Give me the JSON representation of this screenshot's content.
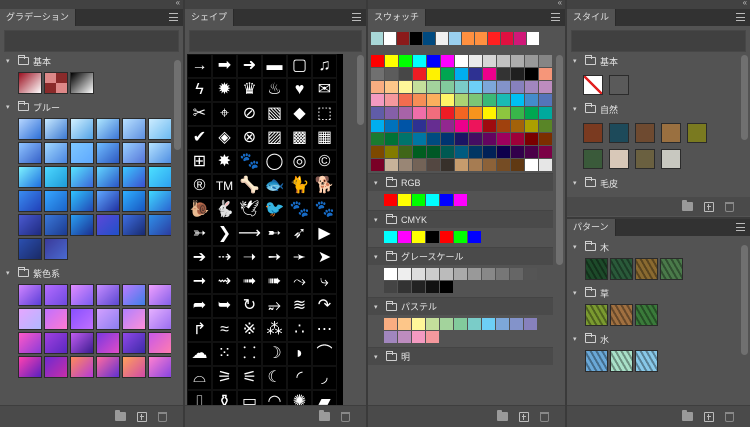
{
  "gradients_panel": {
    "tab": "グラデーション",
    "groups": [
      {
        "name": "基本",
        "items": [
          "linear-gradient(135deg,#9b1020,#ffffff)",
          "repeating-conic-gradient(#8a2a2a 0 25%,#d88 0 50%)",
          "linear-gradient(135deg,#000000,#ffffff)"
        ]
      },
      {
        "name": "ブルー",
        "items": [
          "linear-gradient(135deg,#b6d6ff,#2d6fd6)",
          "linear-gradient(135deg,#c6e8ff,#3b78d0)",
          "linear-gradient(135deg,#d2f1ff,#52a2e6)",
          "linear-gradient(135deg,#aee6ff,#3c76d6)",
          "linear-gradient(135deg,#b8e0ff,#5d8fe0)",
          "linear-gradient(135deg,#ccecff,#6bb9f0)",
          "linear-gradient(135deg,#8fc4ff,#3560c8)",
          "linear-gradient(135deg,#a0d8ff,#4a84e0)",
          "linear-gradient(135deg,#7ec8ff,#5ea8ff)",
          "linear-gradient(135deg,#6fbcff,#2d58c0)",
          "linear-gradient(135deg,#98d0ff,#5575d8)",
          "linear-gradient(135deg,#b5e3ff,#4e8de2)",
          "linear-gradient(135deg,#7df2ff,#1f6fe0)",
          "linear-gradient(135deg,#4dd8ff,#1e9ad8)",
          "linear-gradient(135deg,#58e5ff,#3a66d9)",
          "linear-gradient(135deg,#62d4ff,#2b55c6)",
          "linear-gradient(135deg,#3cc8ff,#3b4fd0)",
          "linear-gradient(135deg,#4ce0ff,#2ea0f0)",
          "linear-gradient(135deg,#3a8cf0,#2140b8)",
          "linear-gradient(135deg,#36a6ff,#1b63c8)",
          "linear-gradient(135deg,#2fc4ff,#2247b5)",
          "linear-gradient(135deg,#5fa8ff,#2030a0)",
          "linear-gradient(135deg,#2fb0ff,#1855c0)",
          "linear-gradient(135deg,#40d8ff,#2a62d0)",
          "linear-gradient(135deg,#4a5ad0,#1e2a80)",
          "linear-gradient(135deg,#3a78d8,#1c3a90)",
          "linear-gradient(135deg,#2a9ef0,#1b2f90)",
          "linear-gradient(135deg,#5c48d8,#2050c8)",
          "linear-gradient(135deg,#3e6ee0,#182a70)",
          "linear-gradient(135deg,#2f8fe8,#2b3ca0)",
          "linear-gradient(135deg,#2b4fb0,#1a2a66)",
          "linear-gradient(135deg,#3a3a9a,#4a6ad0)"
        ]
      },
      {
        "name": "紫色系",
        "items": [
          "linear-gradient(135deg,#d084ff,#5a3fd8)",
          "linear-gradient(135deg,#b46bff,#6e4ae0)",
          "linear-gradient(135deg,#e08cff,#7a5cf0)",
          "linear-gradient(135deg,#c58bff,#5a48d0)",
          "linear-gradient(135deg,#ba7cff,#3f7ee8)",
          "linear-gradient(135deg,#f0a0ff,#8460e8)",
          "linear-gradient(135deg,#e6a6ff,#b0b8ff)",
          "linear-gradient(135deg,#c070ff,#ff7ad0)",
          "linear-gradient(135deg,#8850ff,#c070ff)",
          "linear-gradient(135deg,#d3a0ff,#8c7ef0)",
          "linear-gradient(135deg,#b080ff,#ff90d8)",
          "linear-gradient(135deg,#e6b0ff,#9a6ef0)",
          "linear-gradient(135deg,#ff58c8,#8a3cd8)",
          "linear-gradient(135deg,#a040e0,#5a28c0)",
          "linear-gradient(135deg,#c05cf0,#3b1c90)",
          "linear-gradient(135deg,#7a38e0,#e04cc8)",
          "linear-gradient(135deg,#9048e8,#3c2aa8)",
          "linear-gradient(135deg,#c858e8,#ff7cb0)",
          "linear-gradient(135deg,#ff40b0,#5820c0)",
          "linear-gradient(135deg,#6f2ad0,#c82ea8)",
          "linear-gradient(135deg,#ff8a5a,#b43ad8)",
          "linear-gradient(135deg,#ff6aa0,#6030d0)",
          "linear-gradient(135deg,#ffa05a,#d04aa8)",
          "linear-gradient(135deg,#ff80d0,#8844e0)"
        ]
      }
    ]
  },
  "shapes_panel": {
    "tab": "シェイプ",
    "shapes": [
      "→",
      "➡",
      "➜",
      "▬",
      "▢",
      "♫",
      "ϟ",
      "✹",
      "♛",
      "♨",
      "♥",
      "✉",
      "✂",
      "⌖",
      "⊘",
      "▧",
      "◆",
      "⬚",
      "✔",
      "◈",
      "⊗",
      "▨",
      "▩",
      "▦",
      "⊞",
      "✸",
      "🐾",
      "◯",
      "◎",
      "©",
      "®",
      "TM",
      "🦴",
      "🐟",
      "🐈",
      "🐕",
      "🐌",
      "🐇",
      "🕊",
      "🐦",
      "🐾",
      "🐾",
      "➳",
      "❯",
      "⟶",
      "➸",
      "➶",
      "▶",
      "➔",
      "⇢",
      "➝",
      "➙",
      "➛",
      "➤",
      "➞",
      "⇝",
      "➟",
      "➠",
      "⤳",
      "⤷",
      "➦",
      "➥",
      "↻",
      "⥴",
      "≋",
      "↷",
      "↱",
      "≈",
      "※",
      "⁂",
      "∴",
      "⋯",
      "☁",
      "⁙",
      "⸬",
      "☽",
      "◗",
      "⌒",
      "⌓",
      "⚞",
      "⚟",
      "☾",
      "◜",
      "◞",
      "⎍",
      "⚱",
      "▭",
      "◠",
      "✺",
      "▰"
    ]
  },
  "swatches_panel": {
    "tab": "スウォッチ",
    "recent": [
      "#a8d8d8",
      "#ffffff",
      "#8b1a1a",
      "#000000",
      "#004a80",
      "#f0f0f0",
      "#9ad0f0",
      "#ff9040",
      "#ff9040",
      "#ff2020",
      "#e01040",
      "#d01878",
      "#ffffff"
    ],
    "grid": [
      "#ff0000",
      "#ffff00",
      "#00ff00",
      "#00ffff",
      "#0000ff",
      "#ff00ff",
      "#ffffff",
      "#ebebeb",
      "#d6d6d6",
      "#c2c2c2",
      "#adadad",
      "#999999",
      "#858585",
      "#707070",
      "#5c5c5c",
      "#474747",
      "#ed1c24",
      "#fff200",
      "#00a651",
      "#00aeef",
      "#2e3192",
      "#ec008c",
      "#333333",
      "#1f1f1f",
      "#000000",
      "#f69679",
      "#f9ad81",
      "#fdc689",
      "#fff799",
      "#c4df9b",
      "#a3d39c",
      "#82ca9c",
      "#7accc8",
      "#6dcff6",
      "#7da7d9",
      "#8393ca",
      "#8781bd",
      "#a186be",
      "#bd8cbf",
      "#f49ac1",
      "#f5989d",
      "#f26c4f",
      "#f68e56",
      "#fbaf5d",
      "#fff467",
      "#acd373",
      "#7cc576",
      "#3bb878",
      "#1abbb4",
      "#00bff3",
      "#438ccb",
      "#5574b9",
      "#605ca8",
      "#855fa8",
      "#a763a8",
      "#f06ea9",
      "#f26d7d",
      "#ed1c24",
      "#f26522",
      "#f7941d",
      "#fff200",
      "#8dc63f",
      "#39b54a",
      "#00a651",
      "#00a99d",
      "#00aeef",
      "#0072bc",
      "#0054a6",
      "#2e3192",
      "#662d91",
      "#92278f",
      "#ec008c",
      "#ed145b",
      "#9e0b0f",
      "#a0410d",
      "#a3620a",
      "#aba000",
      "#598527",
      "#1a7b30",
      "#007236",
      "#00746b",
      "#0076a3",
      "#004b80",
      "#003471",
      "#1b1464",
      "#440e62",
      "#630460",
      "#9e005d",
      "#9e0039",
      "#790000",
      "#7b2e00",
      "#7d4900",
      "#827b00",
      "#406618",
      "#005e20",
      "#005826",
      "#005952",
      "#005b7f",
      "#003663",
      "#002157",
      "#0d004c",
      "#32004b",
      "#4b0049",
      "#7b0046",
      "#7a0026",
      "#c7b299",
      "#998675",
      "#736357",
      "#534741",
      "#37302a",
      "#c69c6d",
      "#a67c52",
      "#8c6239",
      "#754c24",
      "#603913",
      "#ffffff",
      "#e6e6e6"
    ],
    "groups": [
      {
        "name": "RGB",
        "colors": [
          "#ff0000",
          "#ffff00",
          "#00ff00",
          "#00ffff",
          "#0000ff",
          "#ff00ff"
        ]
      },
      {
        "name": "CMYK",
        "colors": [
          "#00ffff",
          "#ff00ff",
          "#ffff00",
          "#000000",
          "#ff0000",
          "#00ff00",
          "#0000ff"
        ]
      },
      {
        "name": "グレースケール",
        "colors": [
          "#ffffff",
          "#eeeeee",
          "#dddddd",
          "#cccccc",
          "#bbbbbb",
          "#aaaaaa",
          "#999999",
          "#888888",
          "#777777",
          "#666666",
          "#555555",
          "#444444",
          "#333333",
          "#222222",
          "#111111",
          "#000000"
        ]
      },
      {
        "name": "パステル",
        "colors": [
          "#f9ad81",
          "#fdc689",
          "#fff799",
          "#c4df9b",
          "#a3d39c",
          "#82ca9c",
          "#7accc8",
          "#6dcff6",
          "#7da7d9",
          "#8393ca",
          "#8781bd",
          "#a186be",
          "#bd8cbf",
          "#f49ac1",
          "#f5989d"
        ]
      },
      {
        "name": "明",
        "colors": []
      }
    ]
  },
  "styles_panel": {
    "tab": "スタイル",
    "groups": [
      {
        "name": "基本",
        "items": [
          "none",
          "#5a5a5a"
        ]
      },
      {
        "name": "自然",
        "items": [
          "#7a3a20",
          "#1d4a5a",
          "#6e4a30",
          "#9a7040",
          "#7a7a20",
          "#3a5a3a",
          "#d8c8b8",
          "#6a6040",
          "#c8c8c0"
        ]
      },
      {
        "name": "毛皮",
        "items": []
      }
    ]
  },
  "patterns_panel": {
    "tab": "パターン",
    "groups": [
      {
        "name": "木",
        "items": [
          "#1d4a2a",
          "#2a5a3a",
          "#8a6a30",
          "#4a7a4a"
        ]
      },
      {
        "name": "草",
        "items": [
          "#7a9a30",
          "#a07040",
          "#3a7a3a"
        ]
      },
      {
        "name": "水",
        "items": [
          "#6aa8d8",
          "#a8e0c8",
          "#88c8e8"
        ]
      }
    ]
  }
}
